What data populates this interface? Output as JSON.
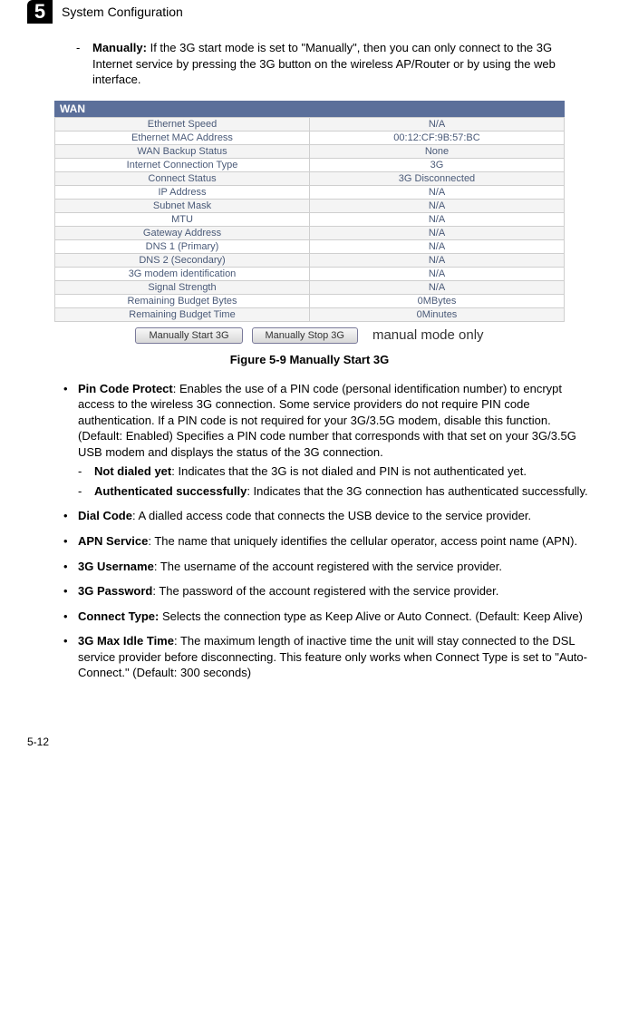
{
  "chapter": {
    "number": "5",
    "title": "System Configuration"
  },
  "intro_dash": {
    "label": "Manually:",
    "text": " If the 3G start mode is set to \"Manually\", then you can only connect to the 3G Internet service by pressing the 3G button on the wireless AP/Router or by using the web interface."
  },
  "wan": {
    "header": "WAN",
    "rows": [
      {
        "label": "Ethernet Speed",
        "value": "N/A"
      },
      {
        "label": "Ethernet MAC Address",
        "value": "00:12:CF:9B:57:BC"
      },
      {
        "label": "WAN Backup Status",
        "value": "None"
      },
      {
        "label": "Internet Connection Type",
        "value": "3G"
      },
      {
        "label": "Connect Status",
        "value": "3G Disconnected"
      },
      {
        "label": "IP Address",
        "value": "N/A"
      },
      {
        "label": "Subnet Mask",
        "value": "N/A"
      },
      {
        "label": "MTU",
        "value": "N/A"
      },
      {
        "label": "Gateway Address",
        "value": "N/A"
      },
      {
        "label": "DNS 1 (Primary)",
        "value": "N/A"
      },
      {
        "label": "DNS 2 (Secondary)",
        "value": "N/A"
      },
      {
        "label": "3G modem identification",
        "value": "N/A"
      },
      {
        "label": "Signal Strength",
        "value": "N/A"
      },
      {
        "label": "Remaining Budget Bytes",
        "value": "0MBytes"
      },
      {
        "label": "Remaining Budget Time",
        "value": "0Minutes"
      }
    ],
    "btn_start": "Manually Start 3G",
    "btn_stop": "Manually Stop 3G",
    "note": "manual mode only"
  },
  "figure_caption": "Figure 5-9  Manually Start 3G",
  "bullets": [
    {
      "bold": "Pin Code Protect",
      "text": ": Enables the use of a PIN code (personal identification number) to encrypt access to the wireless 3G connection. Some service providers do not require PIN code authentication. If a PIN code is not required for your 3G/3.5G modem, disable this function. (Default: Enabled) Specifies a PIN code number that corresponds with that set on your 3G/3.5G USB modem and displays the status of the 3G connection.",
      "subs": [
        {
          "bold": "Not dialed yet",
          "text": ":  Indicates that the 3G is not dialed and PIN is not authenticated yet."
        },
        {
          "bold": "Authenticated successfully",
          "text": ":  Indicates that the 3G connection has authenticated successfully."
        }
      ]
    },
    {
      "bold": "Dial Code",
      "text": ": A dialled access code that connects the USB device to the service provider."
    },
    {
      "bold": "APN Service",
      "text": ": The name that uniquely identifies the cellular operator, access point name (APN)."
    },
    {
      "bold": "3G Username",
      "text": ": The username of the account registered with the service provider."
    },
    {
      "bold": "3G Password",
      "text": ": The password of the account registered with the service provider."
    },
    {
      "bold": "Connect Type:",
      "text": " Selects the connection type as Keep Alive or Auto Connect. (Default: Keep Alive)"
    },
    {
      "bold": "3G Max Idle Time",
      "text": ": The maximum length of inactive time the unit will stay connected to the DSL service provider before disconnecting. This feature only works when Connect Type is set to \"Auto-Connect.\" (Default: 300 seconds)"
    }
  ],
  "page_number": "5-12"
}
